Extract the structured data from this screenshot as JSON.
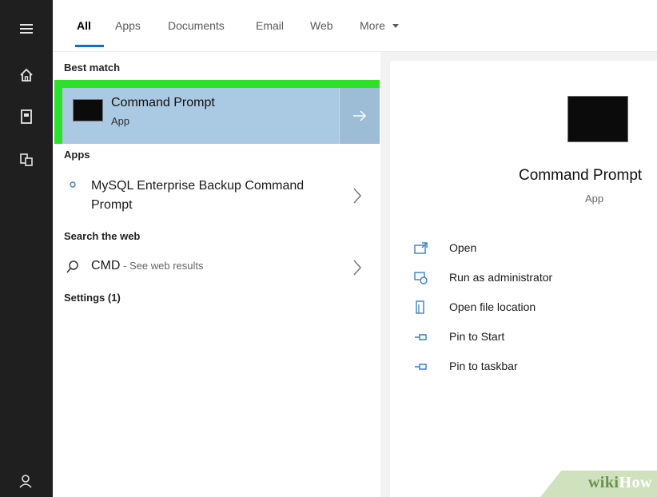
{
  "tabs": [
    "All",
    "Apps",
    "Documents",
    "Email",
    "Web"
  ],
  "more_label": "More",
  "sections": {
    "best_match": "Best match",
    "apps": "Apps",
    "search_web": "Search the web",
    "settings": "Settings (1)"
  },
  "best_match": {
    "title": "Command Prompt",
    "subtitle": "App"
  },
  "apps": [
    {
      "line1": "MySQL Enterprise Backup Command",
      "line2": "Prompt"
    }
  ],
  "web": {
    "query": "CMD",
    "suffix": " - See web results"
  },
  "detail": {
    "title": "Command Prompt",
    "subtitle": "App",
    "actions": [
      "Open",
      "Run as administrator",
      "Open file location",
      "Pin to Start",
      "Pin to taskbar"
    ]
  },
  "watermark": {
    "wiki": "wiki",
    "how": "How"
  },
  "colors": {
    "highlight_border": "#2ee02a",
    "selected_bg": "#aac9e2",
    "accent": "#0a73c7",
    "rail": "#1f1f1f"
  },
  "icons": [
    "hamburger-icon",
    "home-icon",
    "document-icon",
    "apps-icon",
    "user-icon",
    "arrow-right-icon",
    "chevron-right-icon",
    "search-icon",
    "open-icon",
    "run-as-admin-icon",
    "file-location-icon",
    "pin-icon"
  ]
}
